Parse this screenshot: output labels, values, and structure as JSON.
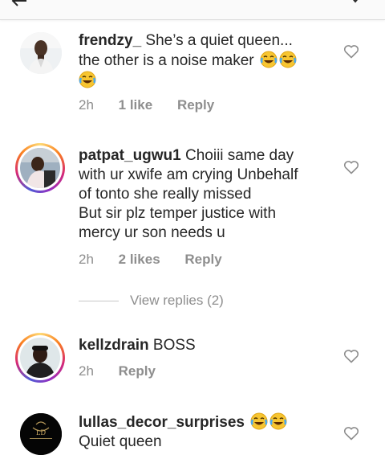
{
  "comments": [
    {
      "username": "frendzy_",
      "text_line1": " She’s a quiet queen...",
      "text_line2": "the other is a noise maker",
      "time": "2h",
      "likes": "1 like",
      "reply": "Reply",
      "laugh_emoji_count": 3
    },
    {
      "username": "patpat_ugwu1",
      "text_line1": " Choiii same day",
      "text_line2": "with ur xwife am crying Unbehalf",
      "text_line3": "of tonto she really missed",
      "text_line4": "But sir plz temper justice with",
      "text_line5": "mercy ur son needs u",
      "time": "2h",
      "likes": "2 likes",
      "reply": "Reply"
    },
    {
      "username": "kellzdrain",
      "text_line1": " BOSS",
      "time": "2h",
      "reply": "Reply"
    },
    {
      "username": "lullas_decor_surprises",
      "text_line2": "Quiet queen",
      "laugh_emoji_count": 2
    }
  ],
  "view_replies": "View replies (2)",
  "icons": {
    "heart": "heart-outline-icon",
    "laugh": "face-with-tears-of-joy-emoji",
    "back": "back-arrow-icon",
    "chevron": "chevron-down-icon"
  },
  "colors": {
    "text": "#262626",
    "meta": "#8e8e8e",
    "story_ring": "#d62976"
  }
}
